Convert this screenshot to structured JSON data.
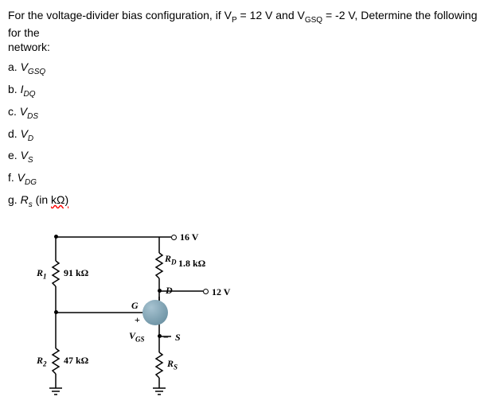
{
  "problem": {
    "intro_a": "For the voltage-divider bias configuration, if V",
    "intro_b": " = 12 V and V",
    "intro_c": " = -2 V, Determine the following for the",
    "intro_d": "network:",
    "sub_p": "P",
    "sub_gso": "GSQ"
  },
  "parts": {
    "a": {
      "prefix": "a. ",
      "sym": "V",
      "sub": "GSQ"
    },
    "b": {
      "prefix": "b. ",
      "sym": "I",
      "sub": "DQ"
    },
    "c": {
      "prefix": "c. ",
      "sym": "V",
      "sub": "DS"
    },
    "d": {
      "prefix": "d. ",
      "sym": "V",
      "sub": "D"
    },
    "e": {
      "prefix": "e. ",
      "sym": "V",
      "sub": "S"
    },
    "f": {
      "prefix": "f. ",
      "sym": "V",
      "sub": "DG"
    },
    "g": {
      "prefix": "g. ",
      "sym": "R",
      "sub": "s",
      "suffix": " (in ",
      "wavy": "kΩ)"
    }
  },
  "circuit": {
    "vcc": "16 V",
    "rd_sym": "R",
    "rd_sub": "D",
    "rd_val": "1.8 kΩ",
    "r1_sym": "R",
    "r1_sub": "1",
    "r1_val": "91 kΩ",
    "r2_sym": "R",
    "r2_sub": "2",
    "r2_val": "47 kΩ",
    "rs_sym": "R",
    "rs_sub": "S",
    "d_label": "D",
    "g_label": "G",
    "s_label": "S",
    "vgs_sym": "V",
    "vgs_sub": "GS",
    "vout": "12 V",
    "plus": "+",
    "minus": "−"
  }
}
